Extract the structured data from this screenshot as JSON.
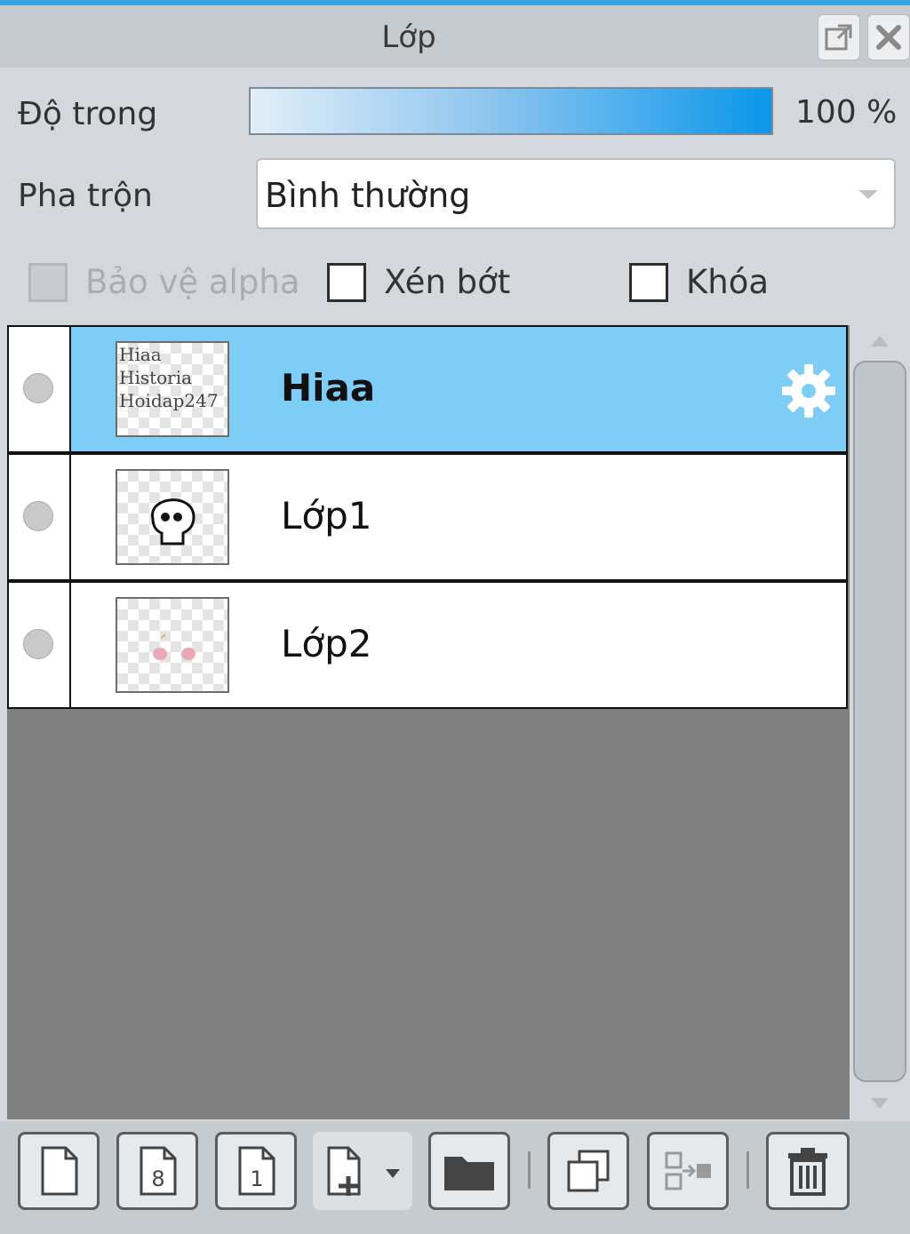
{
  "window": {
    "title": "Lớp",
    "buttons": [
      {
        "name": "popout-button",
        "icon": "popout-icon"
      },
      {
        "name": "close-button",
        "icon": "close-icon"
      }
    ]
  },
  "opacity": {
    "label": "Độ trong",
    "value": "100 %",
    "percent": 100
  },
  "blend": {
    "label": "Pha trộn",
    "selected": "Bình thường"
  },
  "options": {
    "protect_alpha": {
      "label": "Bảo vệ alpha",
      "checked": false,
      "enabled": false
    },
    "clipping": {
      "label": "Xén bớt",
      "checked": false,
      "enabled": true
    },
    "lock": {
      "label": "Khóa",
      "checked": false,
      "enabled": true
    }
  },
  "layers": [
    {
      "name": "Hiaa",
      "selected": true,
      "thumb_text": "Hiaa\nHistoria\nHoidap247",
      "thumb_icon": "text-thumbnail"
    },
    {
      "name": "Lớp1",
      "selected": false,
      "thumb_icon": "skull-sketch-thumbnail"
    },
    {
      "name": "Lớp2",
      "selected": false,
      "thumb_icon": "pink-blush-thumbnail"
    }
  ],
  "toolbar": [
    {
      "name": "new-layer-button",
      "icon": "blank-page-icon"
    },
    {
      "name": "new-8bit-layer-button",
      "icon": "page-8-icon"
    },
    {
      "name": "new-1bit-layer-button",
      "icon": "page-1-icon"
    },
    {
      "name": "add-layer-menu-button",
      "icon": "page-plus-dropdown-icon"
    },
    {
      "name": "new-folder-button",
      "icon": "folder-icon"
    },
    {
      "name": "duplicate-layer-button",
      "icon": "duplicate-icon"
    },
    {
      "name": "merge-down-button",
      "icon": "merge-icon"
    },
    {
      "name": "delete-layer-button",
      "icon": "trash-icon"
    }
  ],
  "colors": {
    "accent": "#37a3df",
    "selected_row": "#7dcdf7",
    "empty_area": "#808080"
  }
}
